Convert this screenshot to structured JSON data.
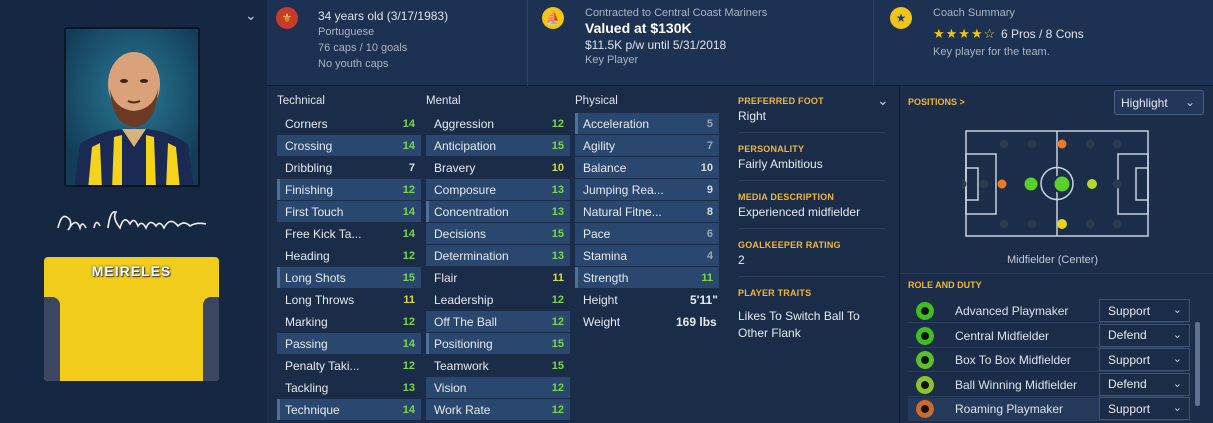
{
  "player": {
    "name_plate": "MEIRELES",
    "signature": "Raúl Meireles",
    "age_line": "34 years old (3/17/1983)",
    "nationality": "Portuguese",
    "caps": "76 caps / 10 goals",
    "youth_caps": "No youth caps"
  },
  "contract": {
    "line1": "Contracted to Central Coast Mariners",
    "value": "Valued at $130K",
    "wage": "$11.5K p/w until 5/31/2018",
    "status": "Key Player"
  },
  "coach": {
    "title": "Coach Summary",
    "stars": "★★★★☆",
    "pros_cons": "6 Pros / 8 Cons",
    "desc": "Key player for the team."
  },
  "attributes": {
    "technical_title": "Technical",
    "mental_title": "Mental",
    "physical_title": "Physical",
    "technical": [
      {
        "name": "Corners",
        "value": "14"
      },
      {
        "name": "Crossing",
        "value": "14"
      },
      {
        "name": "Dribbling",
        "value": "7"
      },
      {
        "name": "Finishing",
        "value": "12"
      },
      {
        "name": "First Touch",
        "value": "14"
      },
      {
        "name": "Free Kick Ta...",
        "value": "14"
      },
      {
        "name": "Heading",
        "value": "12"
      },
      {
        "name": "Long Shots",
        "value": "15"
      },
      {
        "name": "Long Throws",
        "value": "11"
      },
      {
        "name": "Marking",
        "value": "12"
      },
      {
        "name": "Passing",
        "value": "14"
      },
      {
        "name": "Penalty Taki...",
        "value": "12"
      },
      {
        "name": "Tackling",
        "value": "13"
      },
      {
        "name": "Technique",
        "value": "14"
      }
    ],
    "mental": [
      {
        "name": "Aggression",
        "value": "12"
      },
      {
        "name": "Anticipation",
        "value": "15"
      },
      {
        "name": "Bravery",
        "value": "10"
      },
      {
        "name": "Composure",
        "value": "13"
      },
      {
        "name": "Concentration",
        "value": "13"
      },
      {
        "name": "Decisions",
        "value": "15"
      },
      {
        "name": "Determination",
        "value": "13"
      },
      {
        "name": "Flair",
        "value": "11"
      },
      {
        "name": "Leadership",
        "value": "12"
      },
      {
        "name": "Off The Ball",
        "value": "12"
      },
      {
        "name": "Positioning",
        "value": "15"
      },
      {
        "name": "Teamwork",
        "value": "15"
      },
      {
        "name": "Vision",
        "value": "12"
      },
      {
        "name": "Work Rate",
        "value": "12"
      }
    ],
    "physical": [
      {
        "name": "Acceleration",
        "value": "5"
      },
      {
        "name": "Agility",
        "value": "7"
      },
      {
        "name": "Balance",
        "value": "10"
      },
      {
        "name": "Jumping Rea...",
        "value": "9"
      },
      {
        "name": "Natural Fitne...",
        "value": "8"
      },
      {
        "name": "Pace",
        "value": "6"
      },
      {
        "name": "Stamina",
        "value": "4"
      },
      {
        "name": "Strength",
        "value": "11"
      }
    ],
    "height_label": "Height",
    "height": "5'11\"",
    "weight_label": "Weight",
    "weight": "169 lbs"
  },
  "info": {
    "foot_label": "PREFERRED FOOT",
    "foot": "Right",
    "personality_label": "PERSONALITY",
    "personality": "Fairly Ambitious",
    "media_label": "MEDIA DESCRIPTION",
    "media": "Experienced midfielder",
    "gk_label": "GOALKEEPER RATING",
    "gk": "2",
    "traits_label": "PLAYER TRAITS",
    "traits": "Likes To Switch Ball To Other Flank"
  },
  "positions": {
    "title": "POSITIONS",
    "arrow": ">",
    "highlight_button": "Highlight",
    "position_name": "Midfielder (Center)",
    "role_duty_title": "ROLE AND DUTY",
    "roles": [
      {
        "name": "Advanced Playmaker",
        "duty": "Support"
      },
      {
        "name": "Central Midfielder",
        "duty": "Defend"
      },
      {
        "name": "Box To Box Midfielder",
        "duty": "Support"
      },
      {
        "name": "Ball Winning Midfielder",
        "duty": "Defend"
      },
      {
        "name": "Roaming Playmaker",
        "duty": "Support"
      }
    ]
  },
  "colors": {
    "accent_orange": "#f0b73a",
    "rating_green": "#7dd64a",
    "rating_yellow": "#d8dc3c",
    "badge_yellow": "#f0c419"
  }
}
